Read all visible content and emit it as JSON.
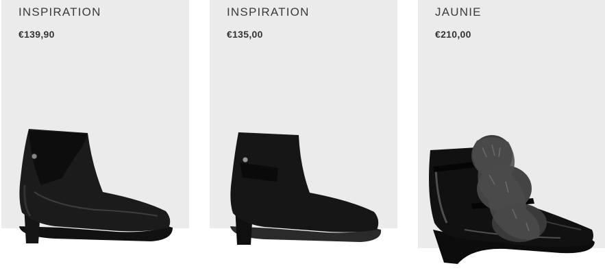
{
  "products": [
    {
      "name": "INSPIRATION",
      "price": "€139,90",
      "image_icon": "black-leather-ankle-boot"
    },
    {
      "name": "INSPIRATION",
      "price": "€135,00",
      "image_icon": "black-suede-ankle-boot"
    },
    {
      "name": "JAUNIE",
      "price": "€210,00",
      "image_icon": "black-patent-fur-wedge-boot"
    }
  ]
}
